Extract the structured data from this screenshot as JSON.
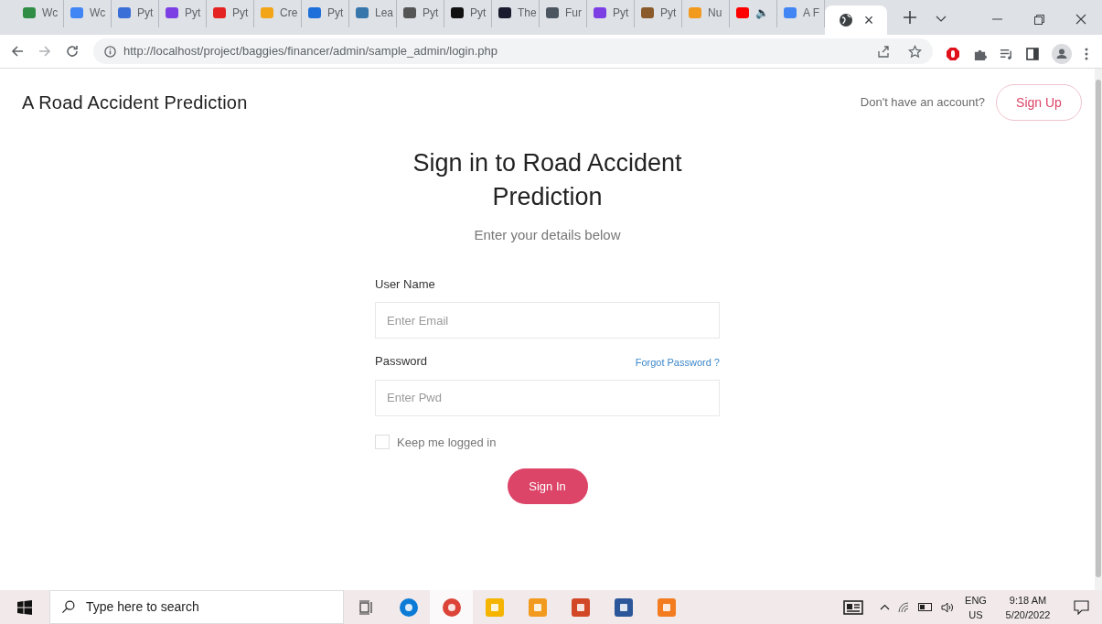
{
  "browser": {
    "tabs": [
      {
        "label": "Wc",
        "color": "#2f8d46",
        "selected": false
      },
      {
        "label": "Wc",
        "color": "#4285f4",
        "selected": false
      },
      {
        "label": "Pyt",
        "color": "#3b6fd8",
        "selected": false
      },
      {
        "label": "Pyt",
        "color": "#7b3fe4",
        "selected": false
      },
      {
        "label": "Pyt",
        "color": "#e52222",
        "selected": false
      },
      {
        "label": "Cre",
        "color": "#f2a516",
        "selected": false
      },
      {
        "label": "Pyt",
        "color": "#1e6fd9",
        "selected": false
      },
      {
        "label": "Lea",
        "color": "#3776ab",
        "selected": false
      },
      {
        "label": "Pyt",
        "color": "#555555",
        "selected": false
      },
      {
        "label": "Pyt",
        "color": "#111111",
        "selected": false
      },
      {
        "label": "The",
        "color": "#1a1a2e",
        "selected": false
      },
      {
        "label": "Fur",
        "color": "#4a5560",
        "selected": false
      },
      {
        "label": "Pyt",
        "color": "#7b3fe4",
        "selected": false
      },
      {
        "label": "Pyt",
        "color": "#8a5a2b",
        "selected": false
      },
      {
        "label": "Nu",
        "color": "#f29a1d",
        "selected": false
      },
      {
        "label": "🔈",
        "color": "#ff0000",
        "selected": false
      },
      {
        "label": "A F",
        "color": "#4285f4",
        "selected": false
      },
      {
        "label": "×",
        "color": "#3c4043",
        "selected": true
      }
    ],
    "url": "http://localhost/project/baggies/financer/admin/sample_admin/login.php"
  },
  "header": {
    "brand": "A Road Accident Prediction",
    "prompt": "Don't have an account?",
    "signup": "Sign Up"
  },
  "form": {
    "title": "Sign in to Road Accident Prediction",
    "subtitle": "Enter your details below",
    "username_label": "User Name",
    "username_placeholder": "Enter Email",
    "password_label": "Password",
    "forgot": "Forgot Password ?",
    "password_placeholder": "Enter Pwd",
    "remember": {
      "label": "Keep me logged in",
      "checked": false
    },
    "submit": "Sign In"
  },
  "taskbar": {
    "search_placeholder": "Type here to search",
    "apps": [
      {
        "color": "#0c7bd6",
        "selected": false
      },
      {
        "color": "#db4437",
        "selected": true
      },
      {
        "color": "#f4b400",
        "selected": false
      },
      {
        "color": "#f29a1d",
        "selected": false
      },
      {
        "color": "#d24726",
        "selected": false
      },
      {
        "color": "#2b579a",
        "selected": false
      },
      {
        "color": "#f37c20",
        "selected": false
      }
    ],
    "language": "ENG",
    "region": "US",
    "time": "9:18 AM",
    "date": "5/20/2022"
  }
}
